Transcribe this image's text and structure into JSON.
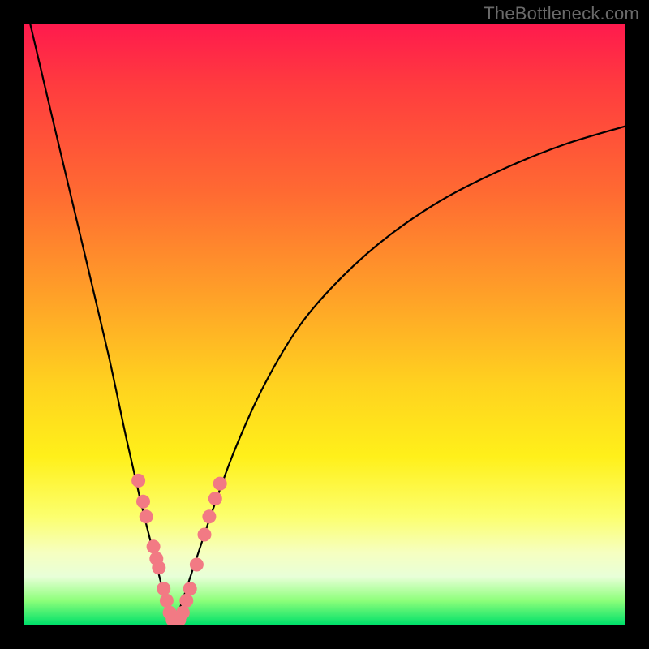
{
  "watermark": "TheBottleneck.com",
  "colors": {
    "frame": "#000000",
    "curve": "#000000",
    "dot_fill": "#f27a84",
    "dot_stroke": "#c94b57"
  },
  "chart_data": {
    "type": "line",
    "title": "",
    "xlabel": "",
    "ylabel": "",
    "xlim": [
      0,
      100
    ],
    "ylim": [
      0,
      100
    ],
    "grid": false,
    "legend": false,
    "series": [
      {
        "name": "left-branch",
        "x": [
          1,
          5,
          10,
          14,
          17,
          19.5,
          21.5,
          23,
          24,
          25
        ],
        "y": [
          100,
          83,
          62,
          45,
          31,
          20,
          12,
          6,
          2,
          0
        ]
      },
      {
        "name": "right-branch",
        "x": [
          25,
          26,
          28,
          31,
          35,
          40,
          46,
          53,
          61,
          70,
          80,
          90,
          100
        ],
        "y": [
          0,
          3,
          9,
          18,
          29,
          40,
          50,
          58,
          65,
          71,
          76,
          80,
          83
        ]
      }
    ],
    "scatter": {
      "name": "highlight-dots",
      "points": [
        {
          "x": 19.0,
          "y": 24.0
        },
        {
          "x": 19.8,
          "y": 20.5
        },
        {
          "x": 20.3,
          "y": 18.0
        },
        {
          "x": 21.5,
          "y": 13.0
        },
        {
          "x": 22.0,
          "y": 11.0
        },
        {
          "x": 22.4,
          "y": 9.5
        },
        {
          "x": 23.2,
          "y": 6.0
        },
        {
          "x": 23.7,
          "y": 4.0
        },
        {
          "x": 24.2,
          "y": 2.0
        },
        {
          "x": 24.7,
          "y": 0.8
        },
        {
          "x": 25.2,
          "y": 0.4
        },
        {
          "x": 25.8,
          "y": 0.8
        },
        {
          "x": 26.4,
          "y": 2.0
        },
        {
          "x": 27.0,
          "y": 4.0
        },
        {
          "x": 27.6,
          "y": 6.0
        },
        {
          "x": 28.7,
          "y": 10.0
        },
        {
          "x": 30.0,
          "y": 15.0
        },
        {
          "x": 30.8,
          "y": 18.0
        },
        {
          "x": 31.8,
          "y": 21.0
        },
        {
          "x": 32.6,
          "y": 23.5
        }
      ]
    }
  }
}
